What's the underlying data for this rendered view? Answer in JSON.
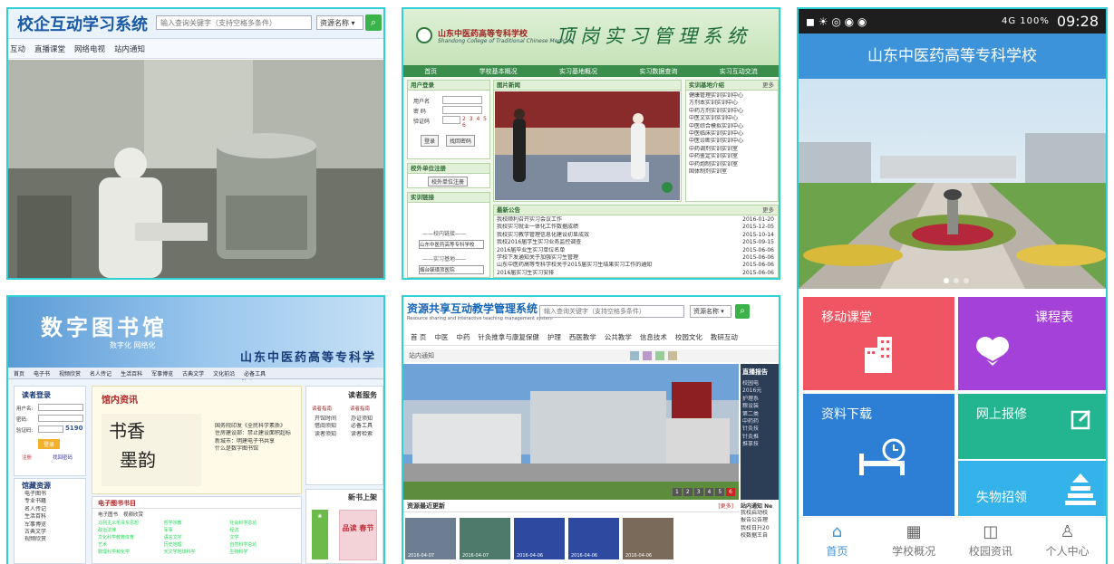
{
  "panel1": {
    "title": "校企互动学习系统",
    "search_placeholder": "输入查询关键字（支持空格多条件）",
    "select_value": "资源名称",
    "nav": [
      "互动",
      "直播课堂",
      "网络电视",
      "站内通知"
    ]
  },
  "panel2": {
    "school_name": "山东中医药高等专科学校",
    "school_en": "Shandong College of Traditional Chinese Medicine",
    "system_title": "顶岗实习管理系统",
    "nav": [
      "首页",
      "学校基本概况",
      "实习基地概况",
      "实习数据查询",
      "实习互动交流"
    ],
    "login_box": {
      "header": "用户登录",
      "user_label": "用户名",
      "pass_label": "密 码",
      "code_label": "验证码",
      "code_value": "2 3 4 5 6",
      "login_button": "登录",
      "forgot_button": "找回密码"
    },
    "reg_box": {
      "header": "校外单位注册",
      "button": "校外单位注册"
    },
    "nav_box": {
      "header": "实训链接",
      "label1": "——校内链接——",
      "select1": "山东中医药高等专科学校",
      "label2": "——实习基地——",
      "select2": "烟台毓璜顶医院"
    },
    "news_header": "图片新闻",
    "intro_box": {
      "header": "实训基地介绍",
      "more": "更多",
      "items": [
        "健康管理实训实训中心",
        "方剂本实训实训中心",
        "中药方剂实训实训中心",
        "中医文实训实训中心",
        "中医综合模拟实训中心",
        "中医临床实训实训中心",
        "中医诊断实训实训中心",
        "中药调剂实训实训室",
        "中药鉴定实训实训室",
        "中药炮制实训实训室",
        "固体制剂实训室"
      ]
    },
    "latest_box": {
      "header": "最新公告",
      "more": "更多",
      "items": [
        {
          "text": "我校顺利召开实习会议工作",
          "date": "2016-01-20"
        },
        {
          "text": "我校实习就业一体化工作数据成绩",
          "date": "2015-12-05"
        },
        {
          "text": "我校实习教学管理信息化建设初显成效",
          "date": "2015-10-14"
        },
        {
          "text": "我校2016届学生实习业务监控调查",
          "date": "2015-09-15"
        },
        {
          "text": "2016届毕业生实习单位名单",
          "date": "2015-06-06"
        },
        {
          "text": "学校下发通知关于加强实习生管理",
          "date": "2015-06-06"
        },
        {
          "text": "山东中医药高等专科学校关于2015届实习生结果实习工作的通知",
          "date": "2015-06-06"
        },
        {
          "text": "2016届实习生实习安排",
          "date": "2015-06-06"
        }
      ]
    }
  },
  "panel3": {
    "status_left": "◼ ☀ ◎ ◉ ◉",
    "status_right": "4G 100%",
    "time": "09:28",
    "header": "山东中医药高等专科学校",
    "tiles": [
      {
        "label": "移动课堂",
        "icon": "building-icon",
        "color": "#ef5562"
      },
      {
        "label": "课程表",
        "icon": "heart-book-icon",
        "color": "#a441d8"
      },
      {
        "label": "资料下载",
        "icon": "bed-clock-icon",
        "color": "#2d7fd6"
      },
      {
        "label": "网上报修",
        "icon": "edit-icon",
        "color": "#23b58f"
      },
      {
        "label": "失物招领",
        "icon": "stack-icon",
        "color": "#33b3e9"
      }
    ],
    "tabs": [
      "首页",
      "学校概况",
      "校园资讯",
      "个人中心"
    ]
  },
  "panel4": {
    "title": "数字图书馆",
    "subtitle": "数字化 网络化",
    "school": "山东中医药高等专科学校",
    "nav": [
      "首页",
      "电子书",
      "视频欣赏",
      "名人传记",
      "生活百科",
      "军事博览",
      "古典文学",
      "文化前沿",
      "必备工具"
    ],
    "login": {
      "header": "读者登录",
      "user_label": "用户名:",
      "pass_label": "密码:",
      "code_label": "验证码:",
      "code_value": "5190",
      "login_button": "登录",
      "register": "注册",
      "forgot": "找回密码"
    },
    "resources": {
      "header": "馆藏资源",
      "items": [
        "电子图书",
        "专业书籍",
        "名人传记",
        "生活百科",
        "军事博览",
        "古典文学",
        "视频欣赏"
      ]
    },
    "news": {
      "header": "馆内资讯",
      "items": [
        "国务院印发《全民科学素质》",
        "住房建设部：禁止建设面积超标",
        "新城市：明建电子书共享",
        "什么是数字图书馆"
      ]
    },
    "ebook_tab": "电子图书书目",
    "ebook_tabs": [
      "电子图书",
      "视频欣赏"
    ],
    "ebook_items": [
      "马列主义毛泽东思想",
      "哲学宗教",
      "社会科学总论",
      "政治法律",
      "军事",
      "经济",
      "文化科学教育体育",
      "语言文字",
      "文学",
      "艺术",
      "历史地理",
      "自然科学总论",
      "数理科学和化学",
      "天文学地球科学",
      "生物科学"
    ],
    "service": {
      "header": "读者服务",
      "col1": "读者指南",
      "col2": "读者指南",
      "items1": [
        "开馆时间",
        "借阅须知",
        "读者须知"
      ],
      "items2": [
        "办证须知",
        "必备工具",
        "读者检索"
      ]
    },
    "newbook": {
      "header": "新书上架",
      "book_title": "品读 春节"
    }
  },
  "panel5": {
    "title": "资源共享互动教学管理系统",
    "subtitle": "Resource sharing and interactive teaching management system",
    "search_placeholder": "输入查询关键字（支持空格多条件）",
    "select_value": "资源名称",
    "nav": [
      "首 页",
      "中医",
      "中药",
      "针灸推拿与康复保健",
      "护理",
      "西医教学",
      "公共教学",
      "信息技术",
      "校园文化",
      "教研互动"
    ],
    "notice": "站内通知",
    "live_header": "直播报告",
    "live_items": [
      "校园电",
      "2016元",
      "护理系",
      "粮设装",
      "第二类",
      "中药药",
      "针灸技",
      "针灸推",
      "推拿技"
    ],
    "pager": [
      "1",
      "2",
      "3",
      "4",
      "5",
      "6"
    ],
    "latest_header": "资源最近更新",
    "latest_more": "[更多]",
    "thumbs": [
      "2016-04-07",
      "2016-04-07",
      "2016-04-06",
      "2016-04-06",
      "2016-04-06"
    ],
    "station_header": "站内通知 Ne",
    "station_items": [
      "我校启动校",
      "报告公告理",
      "我校日升20",
      "校数据王自"
    ]
  }
}
